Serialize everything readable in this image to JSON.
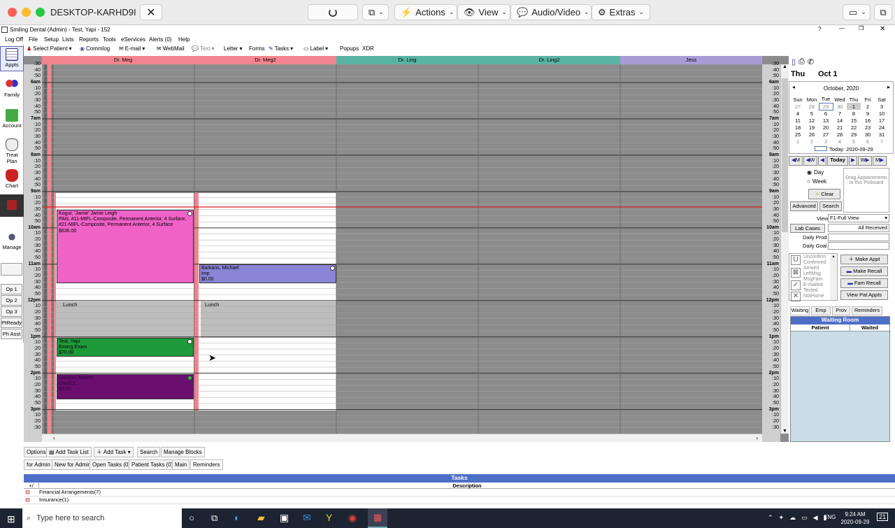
{
  "mac": {
    "title": "DESKTOP-KARHD9I",
    "actions": "Actions",
    "view": "View",
    "audio": "Audio/Video",
    "extras": "Extras"
  },
  "window": {
    "title": "Smiling Dental (Admin) - Test, Yapi - 152",
    "help": "?"
  },
  "menu": [
    "Log Off",
    "File",
    "Setup",
    "Lists",
    "Reports",
    "Tools",
    "eServices",
    "Alerts (0)",
    "Help"
  ],
  "toolbar": {
    "select_patient": "Select Patient",
    "commlog": "Commlog",
    "email": "E-mail",
    "webmail": "WebMail",
    "text": "Text",
    "letter": "Letter",
    "forms": "Forms",
    "tasks": "Tasks",
    "label": "Label",
    "popups": "Popups",
    "xdr": "XDR"
  },
  "modules": {
    "appts": "Appts",
    "family": "Family",
    "account": "Account",
    "treat": "Treat Plan",
    "chart": "Chart",
    "imaging": "Imaging",
    "manage": "Manage"
  },
  "ops": [
    "Op 1",
    "Op 2",
    "Op 3",
    "PtReady",
    "Ph Asst"
  ],
  "providers": [
    {
      "name": "Dr. Meg",
      "color": "#f2858f"
    },
    {
      "name": "Dr. Meg2",
      "color": "#f2858f"
    },
    {
      "name": "Dr. Ling",
      "color": "#59b3a3"
    },
    {
      "name": "Dr. Ling2",
      "color": "#59b3a3"
    },
    {
      "name": "Jess",
      "color": "#a89cd6"
    }
  ],
  "times": [
    ":30",
    ":40",
    ":50",
    "6am",
    ":10",
    ":20",
    ":30",
    ":40",
    ":50",
    "7am",
    ":10",
    ":20",
    ":30",
    ":40",
    ":50",
    "8am",
    ":10",
    ":20",
    ":30",
    ":40",
    ":50",
    "9am",
    ":10",
    ":20",
    ":30",
    ":40",
    ":50",
    "10am",
    ":10",
    ":20",
    ":30",
    ":40",
    ":50",
    "11am",
    ":10",
    ":20",
    ":30",
    ":40",
    ":50",
    "12pm",
    ":10",
    ":20",
    ":30",
    ":40",
    ":50",
    "1pm",
    ":10",
    ":20",
    ":30",
    ":40",
    ":50",
    "2pm",
    ":10",
    ":20",
    ":30",
    ":40",
    ":50",
    "3pm",
    ":10",
    ":20",
    ":30"
  ],
  "appointments": {
    "a1": {
      "name": "Kogut, 'Jamie' Jamie Leigh",
      "proc": "PAN, #11-MIFL-Composite, Permanent Anterior, 4 Surface, #21-MIFL-Composite, Permanent Anterior, 4 Surface",
      "fee": "$636.00",
      "color": "#f062c8"
    },
    "a2": {
      "name": "Barkans, Michael",
      "proc": "Imp",
      "fee": "$0.00",
      "color": "#8a85d6"
    },
    "a3": {
      "name": "Test, Yapi",
      "proc": "Emerg Exam",
      "fee": "$70.00",
      "color": "#1f9a3a"
    },
    "a4": {
      "name": "Carlson, Robert",
      "proc": "ChiIdCl...",
      "fee": "$0.00",
      "color": "#6a0f70"
    },
    "lunch": "Lunch"
  },
  "calendar": {
    "dayname": "Thu",
    "date": "Oct 1",
    "month": "October, 2020",
    "dow": [
      "Sun",
      "Mon",
      "Tue",
      "Wed",
      "Thu",
      "Fri",
      "Sat"
    ],
    "weeks": [
      [
        "27",
        "28",
        "29",
        "30",
        "1",
        "2",
        "3"
      ],
      [
        "4",
        "5",
        "6",
        "7",
        "8",
        "9",
        "10"
      ],
      [
        "11",
        "12",
        "13",
        "14",
        "15",
        "16",
        "17"
      ],
      [
        "18",
        "19",
        "20",
        "21",
        "22",
        "23",
        "24"
      ],
      [
        "25",
        "26",
        "27",
        "28",
        "29",
        "30",
        "31"
      ],
      [
        "1",
        "2",
        "3",
        "4",
        "5",
        "6",
        "7"
      ]
    ],
    "today": "Today: 2020-09-29"
  },
  "right": {
    "today_btn": "Today",
    "m": "M",
    "w": "W",
    "day": "Day",
    "week": "Week",
    "clear": "Clear",
    "advanced": "Advanced",
    "search": "Search",
    "drag": "Drag Appointments to this Pinboard",
    "view_label": "View",
    "view_value": "F1-Full View",
    "lab_cases": "Lab Cases",
    "all_received": "All Received",
    "daily_prod": "Daily Prod",
    "daily_goal": "Daily Goal",
    "confirm": [
      "Unconfirm",
      "Confirmed",
      "Arrived",
      "LeftMsg",
      "MsgFam",
      "E-mailed",
      "Texted",
      "NotHome"
    ],
    "make_appt": "Make Appt",
    "make_recall": "Make Recall",
    "fam_recall": "Fam Recall",
    "view_pat": "View Pat Appts",
    "tabs": [
      "Waiting",
      "Emp",
      "Prov",
      "Reminders"
    ],
    "waiting_room": "Waiting Room",
    "patient": "Patient",
    "waited": "Waited"
  },
  "bottom": {
    "row1": [
      "Options",
      "Add Task List",
      "Add Task",
      "Search",
      "Manage Blocks"
    ],
    "row2": [
      "for Admin",
      "New for Admin",
      "Open Tasks (0)",
      "Patient Tasks (0)",
      "Main",
      "Reminders"
    ],
    "tasks_title": "Tasks",
    "plus": "+/",
    "description": "Description",
    "rows": [
      "Financial Arrangements(7)",
      "Insurance(1)"
    ]
  },
  "taskbar": {
    "search": "Type here to search",
    "lang": "ENG",
    "time": "9:24 AM",
    "date": "2020-09-29",
    "notif": "21"
  }
}
